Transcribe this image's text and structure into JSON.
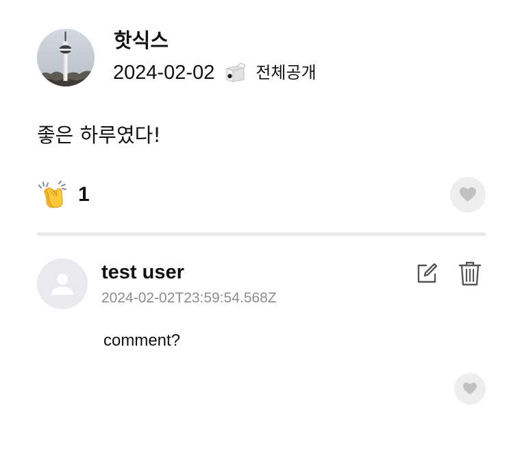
{
  "post": {
    "author": "핫식스",
    "date": "2024-02-02",
    "visibility": "전체공개",
    "content": "좋은 하루였다!",
    "reaction": {
      "emoji": "clapping-hands",
      "count": "1"
    }
  },
  "comment": {
    "author": "test user",
    "timestamp": "2024-02-02T23:59:54.568Z",
    "text": "comment?"
  },
  "colors": {
    "like_bg": "#eeeeee",
    "heart": "#c2c2c2",
    "divider": "#e9e9e9",
    "timestamp": "#8d8d8d",
    "icon_gray": "#555555"
  }
}
